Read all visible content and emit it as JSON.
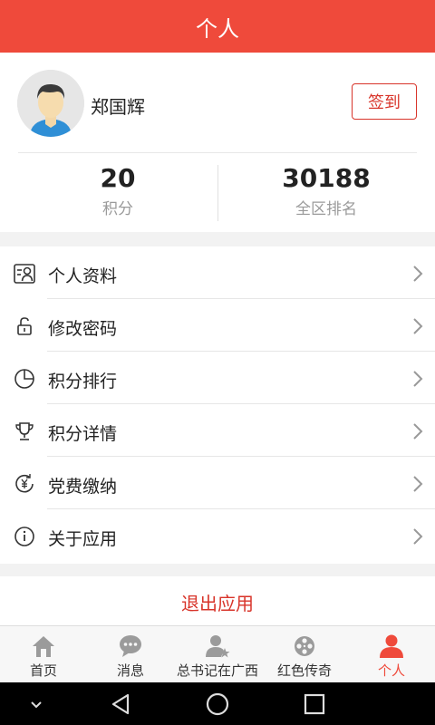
{
  "header": {
    "title": "个人"
  },
  "profile": {
    "username": "郑国辉",
    "signin_label": "签到",
    "stats": [
      {
        "value": "20",
        "label": "积分"
      },
      {
        "value": "30188",
        "label": "全区排名"
      }
    ]
  },
  "menu": {
    "items": [
      {
        "label": "个人资料",
        "icon": "profile-card-icon"
      },
      {
        "label": "修改密码",
        "icon": "unlock-icon"
      },
      {
        "label": "积分排行",
        "icon": "pie-chart-icon"
      },
      {
        "label": "积分详情",
        "icon": "trophy-icon"
      },
      {
        "label": "党费缴纳",
        "icon": "payment-icon"
      },
      {
        "label": "关于应用",
        "icon": "info-icon"
      }
    ]
  },
  "logout_label": "退出应用",
  "tabs": [
    {
      "label": "首页",
      "icon": "home-icon"
    },
    {
      "label": "消息",
      "icon": "message-icon"
    },
    {
      "label": "总书记在广西",
      "icon": "person-star-icon"
    },
    {
      "label": "红色传奇",
      "icon": "film-reel-icon"
    },
    {
      "label": "个人",
      "icon": "user-icon",
      "active": true
    }
  ],
  "colors": {
    "accent": "#ef4a3b",
    "text": "#222222",
    "muted": "#9a9a9a",
    "tab_inactive_icon": "#9b9b9b"
  }
}
